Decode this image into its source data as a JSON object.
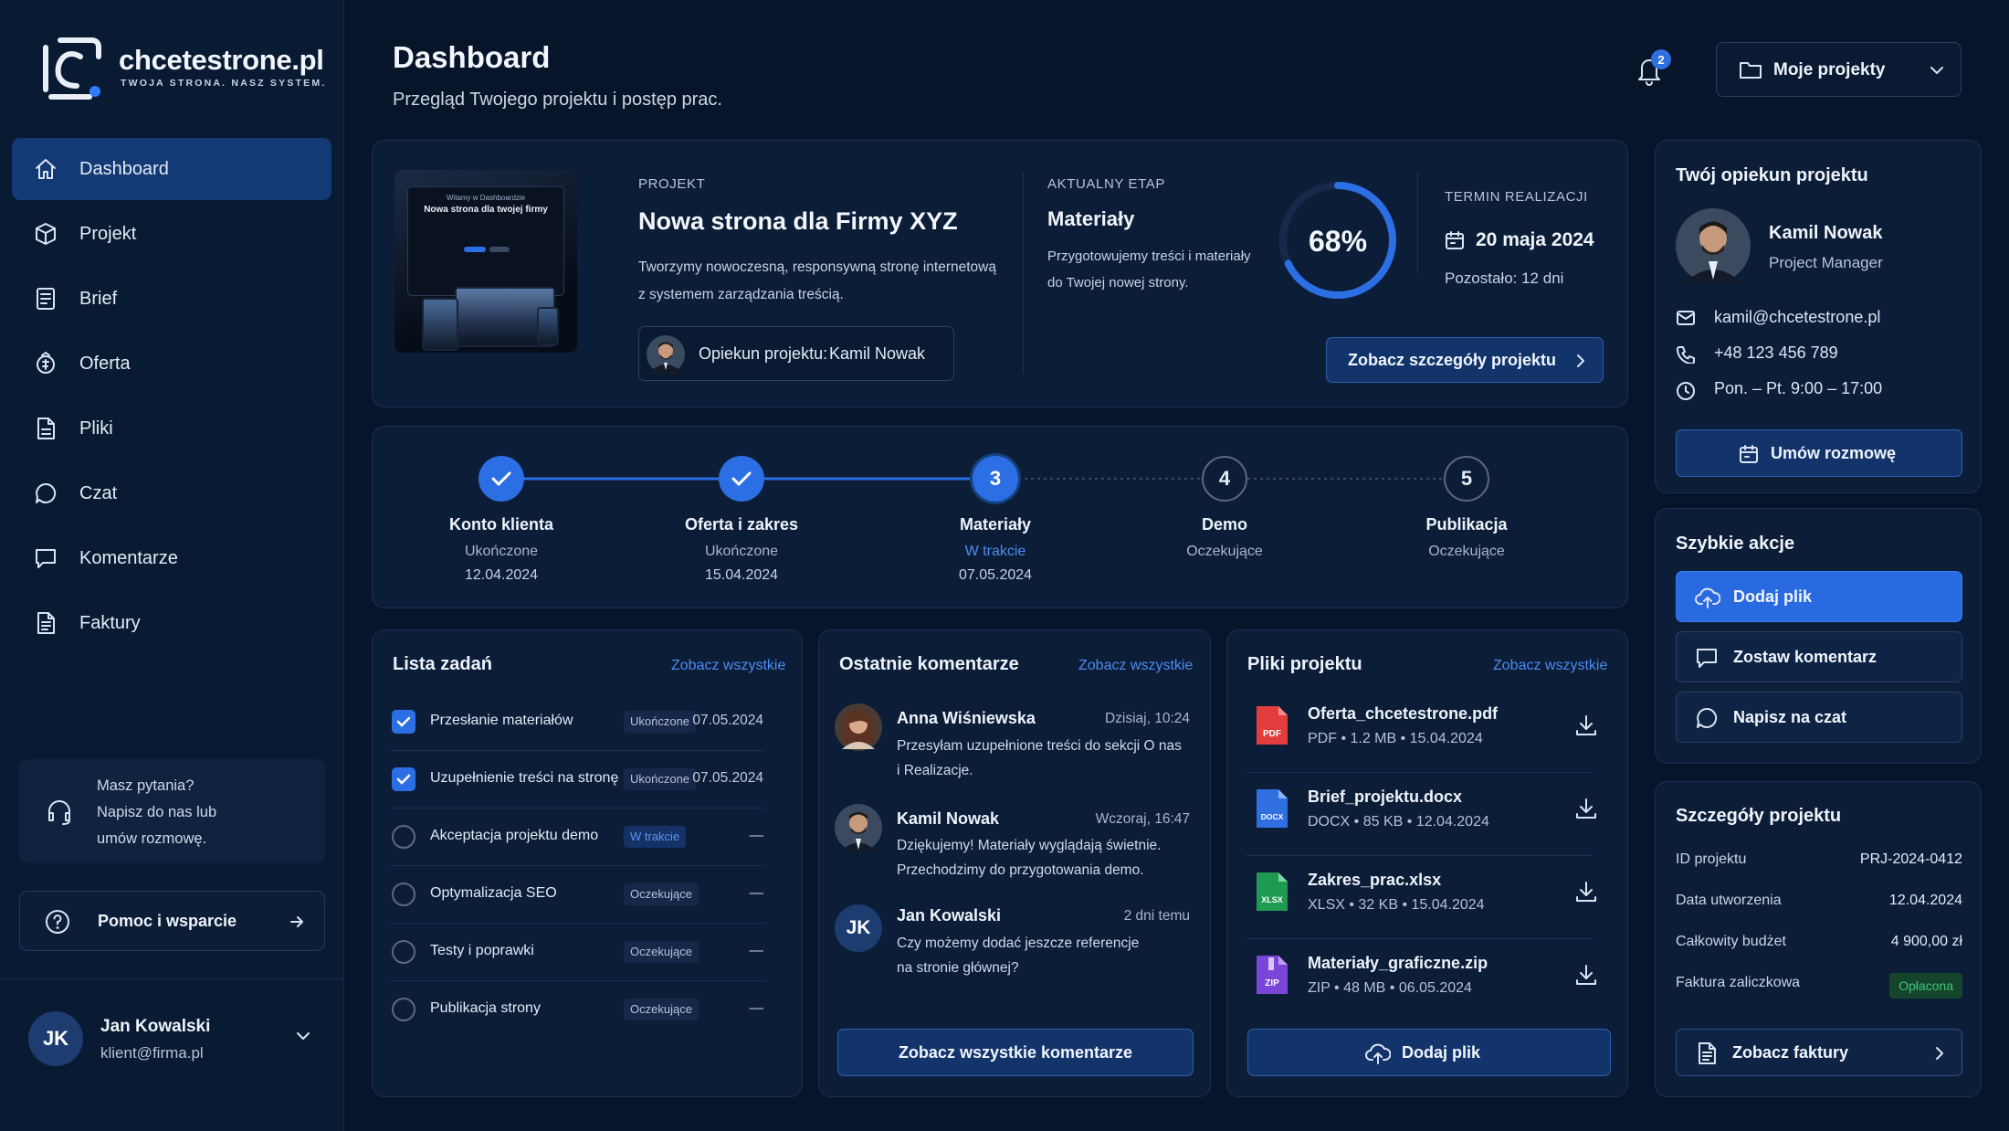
{
  "brand": {
    "name": "chcetestrone.pl",
    "tagline": "TWOJA STRONA. NASZ SYSTEM."
  },
  "sidebar": {
    "items": [
      {
        "label": "Dashboard",
        "icon": "home-icon",
        "active": true
      },
      {
        "label": "Projekt",
        "icon": "cube-icon"
      },
      {
        "label": "Brief",
        "icon": "list-doc-icon"
      },
      {
        "label": "Oferta",
        "icon": "offer-icon"
      },
      {
        "label": "Pliki",
        "icon": "file-icon"
      },
      {
        "label": "Czat",
        "icon": "chat-icon"
      },
      {
        "label": "Komentarze",
        "icon": "comment-icon"
      },
      {
        "label": "Faktury",
        "icon": "invoice-icon"
      }
    ],
    "help": {
      "line1": "Masz pytania?",
      "line2": "Napisz do nas lub",
      "line3": "umów rozmowę."
    },
    "support_label": "Pomoc i wsparcie",
    "user": {
      "initials": "JK",
      "name": "Jan Kowalski",
      "email": "klient@firma.pl"
    }
  },
  "header": {
    "title": "Dashboard",
    "subtitle": "Przegląd Twojego projektu i postęp prac.",
    "notifications": "2",
    "project_select": "Moje projekty"
  },
  "project": {
    "caption": "PROJEKT",
    "name": "Nowa strona dla Firmy XYZ",
    "desc1": "Tworzymy nowoczesną, responsywną stronę internetową",
    "desc2": "z systemem zarządzania treścią.",
    "manager_label": "Opiekun projektu:",
    "manager_name": "Kamil Nowak",
    "mock_title": "Nowa strona dla twojej firmy",
    "mock_kicker": "Witamy w Dashboardzie",
    "stage_caption": "AKTUALNY ETAP",
    "stage_name": "Materiały",
    "stage_desc1": "Przygotowujemy treści i materiały",
    "stage_desc2": "do Twojej nowej strony.",
    "progress_label": "68%",
    "progress": 0.68,
    "deadline_caption": "TERMIN REALIZACJI",
    "deadline": "20 maja 2024",
    "remaining": "Pozostało: 12 dni",
    "details_button": "Zobacz szczegóły projektu"
  },
  "steps": [
    {
      "num": "1",
      "label": "Konto klienta",
      "status": "Ukończone",
      "date": "12.04.2024",
      "state": "done"
    },
    {
      "num": "2",
      "label": "Oferta i zakres",
      "status": "Ukończone",
      "date": "15.04.2024",
      "state": "done"
    },
    {
      "num": "3",
      "label": "Materiały",
      "status": "W trakcie",
      "date": "07.05.2024",
      "state": "current"
    },
    {
      "num": "4",
      "label": "Demo",
      "status": "Oczekujące",
      "date": "",
      "state": "pending"
    },
    {
      "num": "5",
      "label": "Publikacja",
      "status": "Oczekujące",
      "date": "",
      "state": "pending"
    }
  ],
  "tasks": {
    "title": "Lista zadań",
    "see_all": "Zobacz wszystkie",
    "rows": [
      {
        "name": "Przesłanie materiałów",
        "status": "Ukończone",
        "date": "07.05.2024",
        "done": true
      },
      {
        "name": "Uzupełnienie treści na stronę",
        "status": "Ukończone",
        "date": "07.05.2024",
        "done": true
      },
      {
        "name": "Akceptacja projektu demo",
        "status": "W trakcie",
        "date": "—",
        "done": false
      },
      {
        "name": "Optymalizacja SEO",
        "status": "Oczekujące",
        "date": "—",
        "done": false
      },
      {
        "name": "Testy i poprawki",
        "status": "Oczekujące",
        "date": "—",
        "done": false
      },
      {
        "name": "Publikacja strony",
        "status": "Oczekujące",
        "date": "—",
        "done": false
      }
    ]
  },
  "comments": {
    "title": "Ostatnie komentarze",
    "see_all": "Zobacz wszystkie",
    "items": [
      {
        "name": "Anna Wiśniewska",
        "time": "Dzisiaj, 10:24",
        "line1": "Przesyłam uzupełnione treści do sekcji O nas",
        "line2": "i Realizacje."
      },
      {
        "name": "Kamil Nowak",
        "time": "Wczoraj, 16:47",
        "line1": "Dziękujemy! Materiały wyglądają świetnie.",
        "line2": "Przechodzimy do przygotowania demo."
      },
      {
        "name": "Jan Kowalski",
        "time": "2 dni temu",
        "initials": "JK",
        "line1": "Czy możemy dodać jeszcze referencje",
        "line2": "na stronie głównej?"
      }
    ],
    "button": "Zobacz wszystkie komentarze"
  },
  "files": {
    "title": "Pliki projektu",
    "see_all": "Zobacz wszystkie",
    "items": [
      {
        "name": "Oferta_chcetestrone.pdf",
        "meta": "PDF • 1.2 MB • 15.04.2024",
        "type": "PDF",
        "color": "#e23c3c"
      },
      {
        "name": "Brief_projektu.docx",
        "meta": "DOCX • 85 KB • 12.04.2024",
        "type": "DOCX",
        "color": "#2f6fe0"
      },
      {
        "name": "Zakres_prac.xlsx",
        "meta": "XLSX • 32 KB • 15.04.2024",
        "type": "XLSX",
        "color": "#1f9a52"
      },
      {
        "name": "Materiały_graficzne.zip",
        "meta": "ZIP • 48 MB • 06.05.2024",
        "type": "ZIP",
        "color": "#7b45d8"
      }
    ],
    "button": "Dodaj plik"
  },
  "manager": {
    "title": "Twój opiekun projektu",
    "name": "Kamil Nowak",
    "role": "Project Manager",
    "email": "kamil@chcetestrone.pl",
    "phone": "+48 123 456 789",
    "hours": "Pon. – Pt. 9:00 – 17:00",
    "button": "Umów rozmowę"
  },
  "quick": {
    "title": "Szybkie akcje",
    "add_file": "Dodaj plik",
    "comment": "Zostaw komentarz",
    "chat": "Napisz na czat"
  },
  "details": {
    "title": "Szczegóły projektu",
    "rows": [
      {
        "k": "ID projektu",
        "v": "PRJ-2024-0412"
      },
      {
        "k": "Data utworzenia",
        "v": "12.04.2024"
      },
      {
        "k": "Całkowity budżet",
        "v": "4 900,00 zł"
      },
      {
        "k": "Faktura zaliczkowa",
        "v": "Opłacona"
      }
    ],
    "button": "Zobacz faktury"
  },
  "colors": {
    "accent": "#2c6fe4",
    "bg": "#08142a",
    "card": "#0c1d38",
    "success": "#42c57a"
  }
}
